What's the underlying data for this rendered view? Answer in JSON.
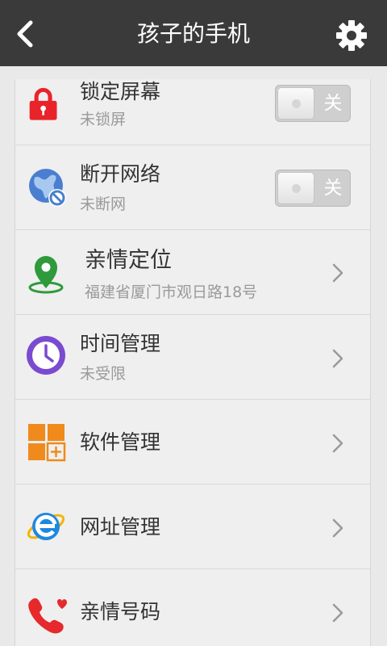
{
  "header": {
    "title": "孩子的手机"
  },
  "rows": [
    {
      "label": "锁定屏幕",
      "sub": "未锁屏",
      "toggle": "关"
    },
    {
      "label": "断开网络",
      "sub": "未断网",
      "toggle": "关"
    },
    {
      "label": "亲情定位",
      "sub": "福建省厦门市观日路18号"
    },
    {
      "label": "时间管理",
      "sub": "未受限"
    },
    {
      "label": "软件管理"
    },
    {
      "label": "网址管理"
    },
    {
      "label": "亲情号码"
    }
  ],
  "colors": {
    "topbar": "#3a3a3a",
    "lock_red": "#e8242a",
    "globe_blue": "#4a7fd0",
    "location_green": "#2f9a3b",
    "clock_purple": "#7a4bd0",
    "apps_orange": "#f08a1c",
    "browser_blue": "#1e88e0",
    "phone_red": "#e5292c"
  }
}
